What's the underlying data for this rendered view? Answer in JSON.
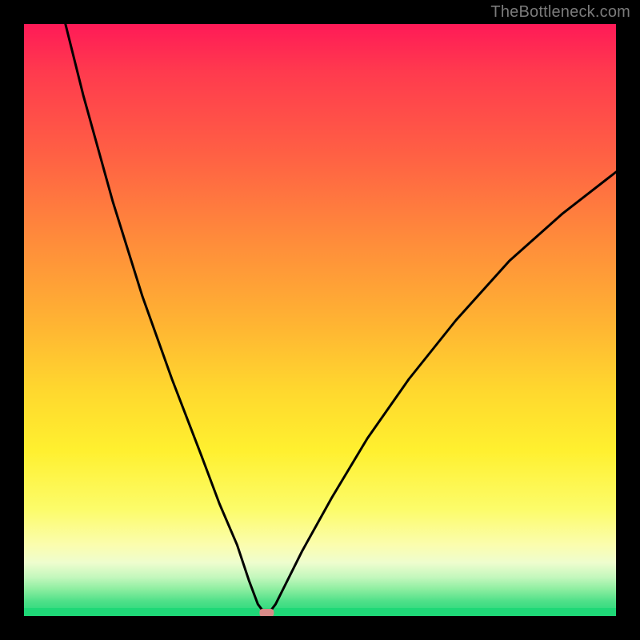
{
  "watermark": "TheBottleneck.com",
  "chart_data": {
    "type": "line",
    "title": "",
    "xlabel": "",
    "ylabel": "",
    "xlim": [
      0,
      100
    ],
    "ylim": [
      0,
      100
    ],
    "grid": false,
    "gradient_bands": [
      {
        "name": "red-pink",
        "color": "#ff1a57",
        "stop_pct": 0
      },
      {
        "name": "orange",
        "color": "#ff8a3b",
        "stop_pct": 36
      },
      {
        "name": "yellow",
        "color": "#ffd82e",
        "stop_pct": 62
      },
      {
        "name": "pale",
        "color": "#fbfdae",
        "stop_pct": 88
      },
      {
        "name": "green",
        "color": "#1fd877",
        "stop_pct": 100
      }
    ],
    "notch": {
      "x": 41,
      "y": 0
    },
    "marker": {
      "x": 41,
      "y": 0,
      "color": "#d98b88"
    },
    "series": [
      {
        "name": "bottleneck-curve",
        "x": [
          0,
          5,
          10,
          15,
          20,
          25,
          30,
          33,
          36,
          38,
          39.5,
          41,
          42.5,
          44,
          47,
          52,
          58,
          65,
          73,
          82,
          91,
          100
        ],
        "y": [
          130,
          108,
          88,
          70,
          54,
          40,
          27,
          19,
          12,
          6,
          2,
          0,
          2,
          5,
          11,
          20,
          30,
          40,
          50,
          60,
          68,
          75
        ]
      }
    ]
  }
}
